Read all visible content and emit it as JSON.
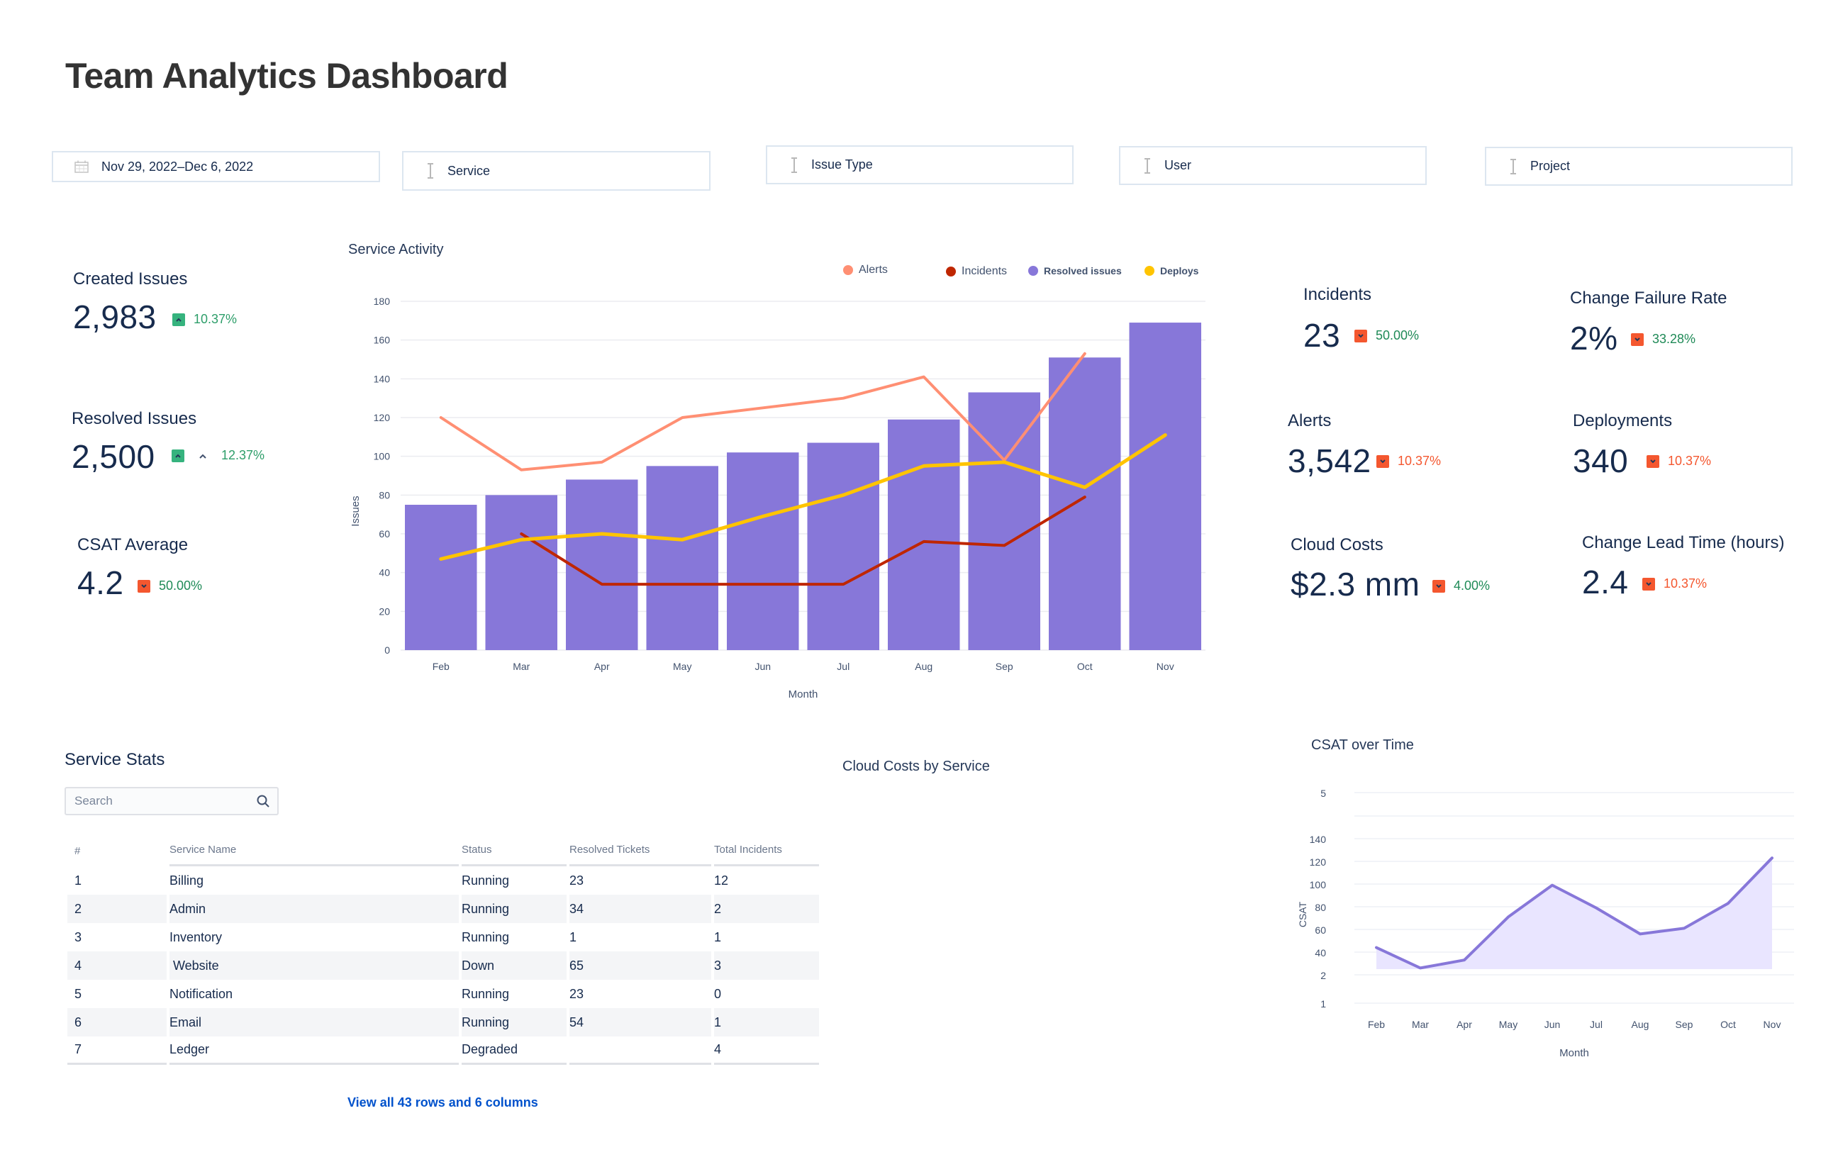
{
  "page": {
    "title": "Team Analytics Dashboard"
  },
  "filters": [
    {
      "name": "date-range-filter",
      "icon": "calendar-icon",
      "value": "Nov 29, 2022–Dec 6, 2022"
    },
    {
      "name": "service-filter",
      "icon": "text-cursor-icon",
      "value": "Service"
    },
    {
      "name": "issue-type-filter",
      "icon": "text-cursor-icon",
      "value": "Issue Type"
    },
    {
      "name": "user-filter",
      "icon": "text-cursor-icon",
      "value": "User"
    },
    {
      "name": "project-filter",
      "icon": "text-cursor-icon",
      "value": "Project"
    }
  ],
  "kpis_left": [
    {
      "label": "Created Issues",
      "value": "2,983",
      "direction": "up",
      "delta": "10.37%"
    },
    {
      "label": "Resolved Issues",
      "value": "2,500",
      "direction": "up",
      "delta": "12.37%",
      "extra_icon": "caret-up-icon"
    },
    {
      "label": "CSAT Average",
      "value": "4.2",
      "direction": "down",
      "delta": "50.00%"
    }
  ],
  "kpis_right": [
    {
      "label": "Incidents",
      "value": "23",
      "direction": "down",
      "delta": "50.00%",
      "delta_tone": "good"
    },
    {
      "label": "Change Failure Rate",
      "value": "2%",
      "direction": "down",
      "delta": "33.28%",
      "delta_tone": "good"
    },
    {
      "label": "Alerts",
      "value": "3,542",
      "direction": "down",
      "delta": "10.37%",
      "delta_tone": "bad"
    },
    {
      "label": "Deployments",
      "value": "340",
      "direction": "down",
      "delta": "10.37%",
      "delta_tone": "bad"
    },
    {
      "label": "Cloud Costs",
      "value": "$2.3 mm",
      "direction": "down",
      "delta": "4.00%",
      "delta_tone": "good"
    },
    {
      "label": "Change Lead Time (hours)",
      "value": "2.4",
      "direction": "down",
      "delta": "10.37%",
      "delta_tone": "bad"
    }
  ],
  "colors": {
    "resolved": "#8777d9",
    "alerts": "#ff8f73",
    "incidents": "#bf2600",
    "deploys": "#ffc400",
    "csat_line": "#8777d9",
    "csat_fill": "#e9e5ff",
    "up": "#36b37e",
    "down": "#f4572f"
  },
  "chart_data": [
    {
      "type": "bar",
      "title": "Service Activity",
      "xlabel": "Month",
      "ylabel": "Issues",
      "ylim": [
        0,
        180
      ],
      "yticks": [
        0,
        20,
        40,
        60,
        80,
        100,
        120,
        140,
        160,
        180
      ],
      "grid": true,
      "legend_position": "top-right",
      "categories": [
        "Feb",
        "Mar",
        "Apr",
        "May",
        "Jun",
        "Jul",
        "Aug",
        "Sep",
        "Oct",
        "Nov"
      ],
      "series": [
        {
          "name": "Resolved issues",
          "kind": "bar",
          "values": [
            75,
            80,
            88,
            95,
            102,
            107,
            119,
            133,
            151,
            169
          ]
        },
        {
          "name": "Alerts",
          "kind": "line",
          "values": [
            120,
            93,
            97,
            120,
            125,
            130,
            141,
            98,
            153,
            null
          ]
        },
        {
          "name": "Incidents",
          "kind": "line",
          "values": [
            null,
            60,
            34,
            34,
            34,
            34,
            56,
            54,
            79,
            null
          ]
        },
        {
          "name": "Deploys",
          "kind": "line",
          "values": [
            47,
            57,
            60,
            57,
            69,
            80,
            95,
            97,
            84,
            111
          ]
        }
      ],
      "legend": [
        "Alerts",
        "Incidents",
        "Resolved issues",
        "Deploys"
      ]
    },
    {
      "type": "area",
      "title": "CSAT over Time",
      "xlabel": "Month",
      "ylabel": "CSAT",
      "grid": true,
      "ytick_labels": [
        "1",
        "2",
        "40",
        "60",
        "80",
        "100",
        "120",
        "140",
        "",
        "5"
      ],
      "ylim": [
        0,
        140
      ],
      "categories": [
        "Feb",
        "Mar",
        "Apr",
        "May",
        "Jun",
        "Jul",
        "Aug",
        "Sep",
        "Oct",
        "Nov"
      ],
      "values": [
        44,
        26,
        33,
        71,
        99,
        79,
        56,
        61,
        83,
        123
      ]
    }
  ],
  "service_stats": {
    "title": "Service Stats",
    "search_placeholder": "Search",
    "columns": [
      "#",
      "Service Name",
      "Status",
      "Resolved Tickets",
      "Total Incidents"
    ],
    "rows": [
      {
        "n": "1",
        "name": "Billing",
        "status": "Running",
        "resolved": "23",
        "incidents": "12"
      },
      {
        "n": "2",
        "name": "Admin",
        "status": "Running",
        "resolved": "34",
        "incidents": "2"
      },
      {
        "n": "3",
        "name": "Inventory",
        "status": "Running",
        "resolved": "1",
        "incidents": "1"
      },
      {
        "n": "4",
        "name": " Website",
        "status": "Down",
        "resolved": "65",
        "incidents": "3"
      },
      {
        "n": "5",
        "name": "Notification",
        "status": "Running",
        "resolved": "23",
        "incidents": "0"
      },
      {
        "n": "6",
        "name": "Email",
        "status": "Running",
        "resolved": "54",
        "incidents": "1"
      },
      {
        "n": "7",
        "name": "Ledger",
        "status": "Degraded",
        "resolved": "",
        "incidents": "4"
      }
    ],
    "view_all": "View all 43 rows and 6 columns"
  },
  "cloud_costs": {
    "title": "Cloud Costs by Service"
  }
}
